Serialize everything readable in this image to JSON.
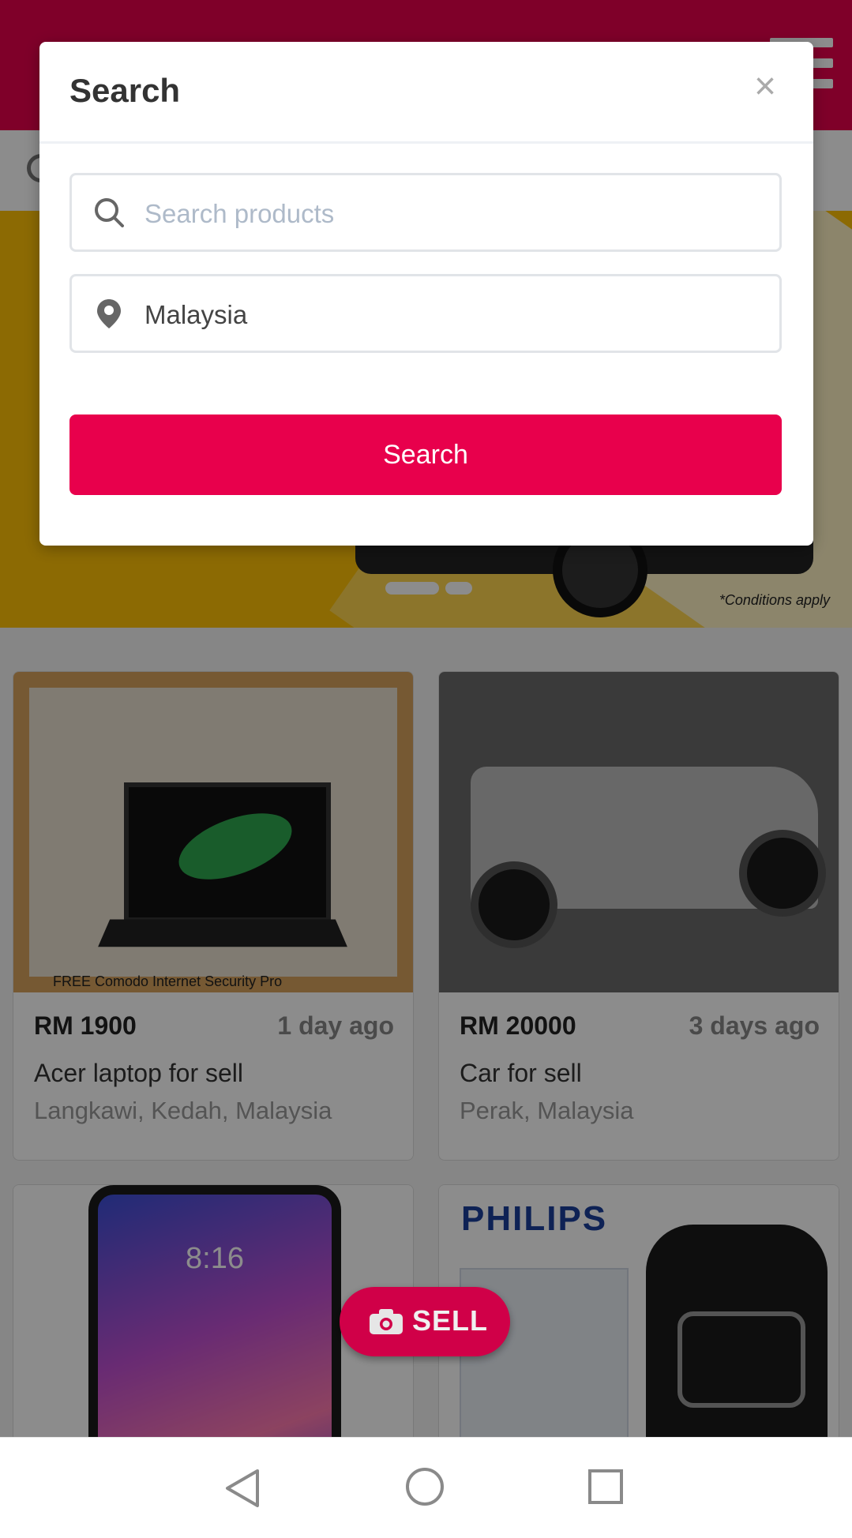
{
  "modal": {
    "title": "Search",
    "close_symbol": "×",
    "search_field": {
      "value": "",
      "placeholder": "Search products",
      "icon": "search-icon"
    },
    "location_field": {
      "value": "Malaysia",
      "icon": "location-pin-icon"
    },
    "search_button": "Search"
  },
  "banner": {
    "conditions": "*Conditions apply"
  },
  "listings": [
    {
      "price": "RM 1900",
      "age": "1 day ago",
      "title": "Acer laptop for sell",
      "location": "Langkawi, Kedah, Malaysia"
    },
    {
      "price": "RM 20000",
      "age": "3 days ago",
      "title": "Car for sell",
      "location": "Perak, Malaysia"
    }
  ],
  "listing_images": {
    "laptop_free_text": "FREE  Comodo Internet Security Pro",
    "phone_time": "8:16",
    "shaver_brand": "PHILIPS"
  },
  "sell_button": {
    "label": "SELL",
    "icon": "camera-icon"
  },
  "colors": {
    "brand": "#e8004c",
    "banner": "#ffc107"
  }
}
